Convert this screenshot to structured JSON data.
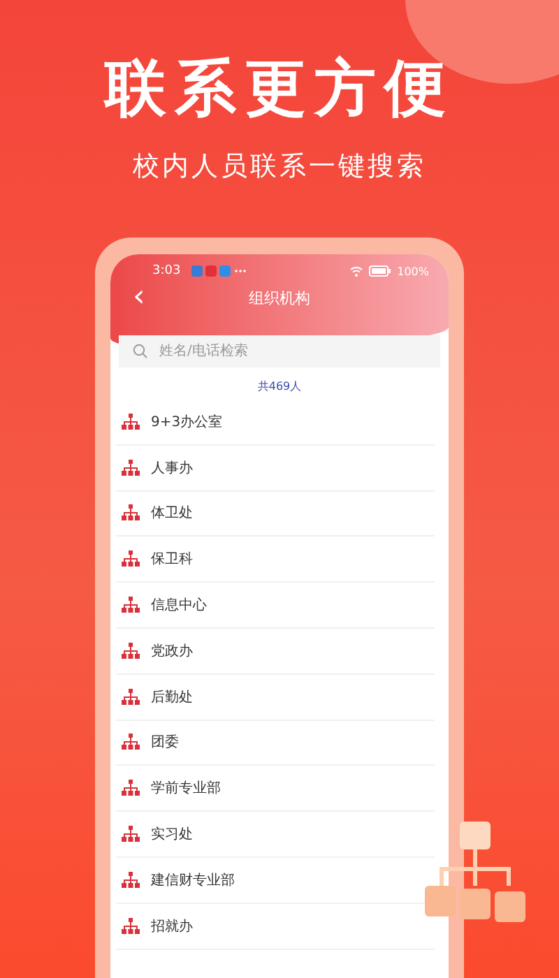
{
  "headline": "联系更方便",
  "subtitle": "校内人员联系一键搜索",
  "status_bar": {
    "time": "3:03",
    "battery": "100%"
  },
  "header": {
    "back": "‹",
    "title": "组织机构"
  },
  "search": {
    "placeholder": "姓名/电话检索"
  },
  "count": "共469人",
  "departments": [
    {
      "name": "9+3办公室"
    },
    {
      "name": "人事办"
    },
    {
      "name": "体卫处"
    },
    {
      "name": "保卫科"
    },
    {
      "name": "信息中心"
    },
    {
      "name": "党政办"
    },
    {
      "name": "后勤处"
    },
    {
      "name": "团委"
    },
    {
      "name": "学前专业部"
    },
    {
      "name": "实习处"
    },
    {
      "name": "建信财专业部"
    },
    {
      "name": "招就办"
    }
  ]
}
